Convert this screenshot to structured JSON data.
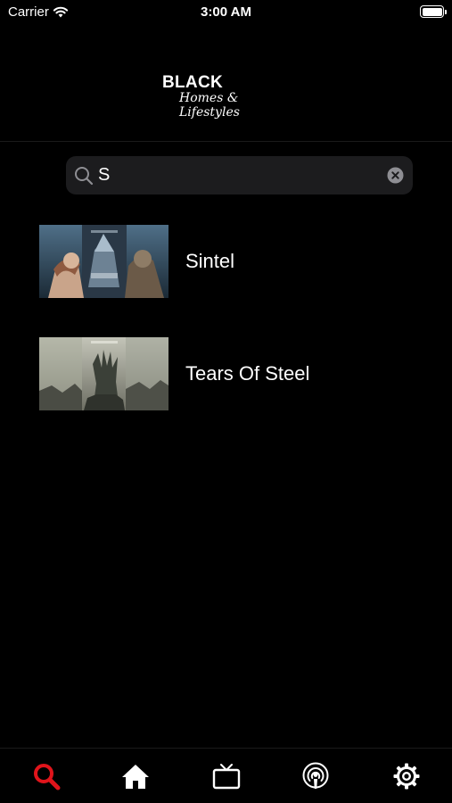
{
  "status_bar": {
    "carrier": "Carrier",
    "time": "3:00 AM"
  },
  "header": {
    "logo_main": "BLACK",
    "logo_sub": "Homes & Lifestyles"
  },
  "search": {
    "value": "S",
    "placeholder": ""
  },
  "results": [
    {
      "title": "Sintel"
    },
    {
      "title": "Tears Of Steel"
    }
  ],
  "tab_bar": {
    "active_color": "#e0141b",
    "inactive_color": "#ffffff",
    "tabs": [
      {
        "icon": "search-icon",
        "active": true
      },
      {
        "icon": "home-icon",
        "active": false
      },
      {
        "icon": "tv-icon",
        "active": false
      },
      {
        "icon": "podcast-icon",
        "active": false
      },
      {
        "icon": "gear-icon",
        "active": false
      }
    ]
  }
}
